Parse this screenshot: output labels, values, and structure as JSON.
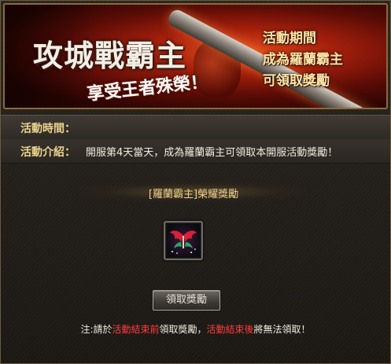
{
  "banner": {
    "title": "攻城戰霸主",
    "subtitle": "享受王者殊榮！",
    "side_lines": [
      "活動期間",
      "成為羅蘭霸主",
      "可領取獎勵"
    ]
  },
  "info": {
    "time_label": "活動時間：",
    "time_value": "",
    "intro_label": "活動介紹：",
    "intro_value": "開服第4天當天，成為羅蘭霸主可領取本開服活動獎勵！"
  },
  "reward": {
    "section_title": "[羅蘭霸主]榮耀獎勵",
    "item_icon": "red-wings-icon"
  },
  "claim_button_label": "領取獎勵",
  "note": {
    "prefix": "注:請於",
    "highlight1": "活動結束前",
    "middle": "領取獎勵，",
    "highlight2": "活動結束後",
    "suffix": "將無法領取！"
  },
  "colors": {
    "label_gold": "#ecd28d",
    "warning_red": "#ff3b3b",
    "banner_red": "#a41f0c"
  }
}
